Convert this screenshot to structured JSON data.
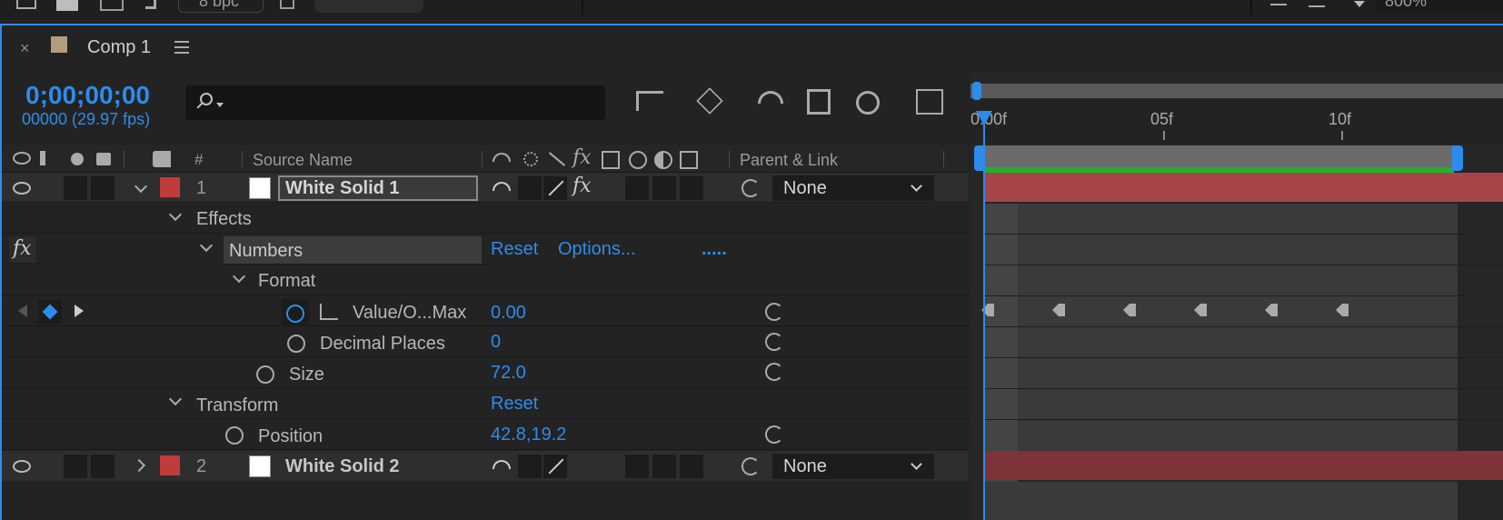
{
  "top": {
    "bpc": "8 bpc",
    "zoom": "800%"
  },
  "panel": {
    "comp_name": "Comp 1"
  },
  "time": {
    "timecode": "0;00;00;00",
    "frames_fps": "00000 (29.97 fps)",
    "search_placeholder": ""
  },
  "columns": {
    "hash": "#",
    "source_name": "Source Name",
    "parent_link": "Parent & Link"
  },
  "ruler": {
    "start": "0:00f",
    "mark1": "05f",
    "mark2": "10f"
  },
  "layers": [
    {
      "num": "1",
      "name": "White Solid 1",
      "parent": "None",
      "color": "#c23b3b"
    },
    {
      "num": "2",
      "name": "White Solid 2",
      "parent": "None",
      "color": "#c23b3b"
    }
  ],
  "effects": {
    "group": "Effects",
    "numbers": "Numbers",
    "reset": "Reset",
    "options": "Options...",
    "dots": ".....",
    "format": "Format",
    "value_label": "Value/O...Max",
    "value": "0.00",
    "decimal_label": "Decimal Places",
    "decimal": "0",
    "size_label": "Size",
    "size": "72.0"
  },
  "transform": {
    "group": "Transform",
    "reset": "Reset",
    "position_label": "Position",
    "position": "42.8,19.2"
  },
  "colors": {
    "accent": "#2d8ceb",
    "layer_bar": "#a8454a",
    "work_area": "#21b22b"
  }
}
